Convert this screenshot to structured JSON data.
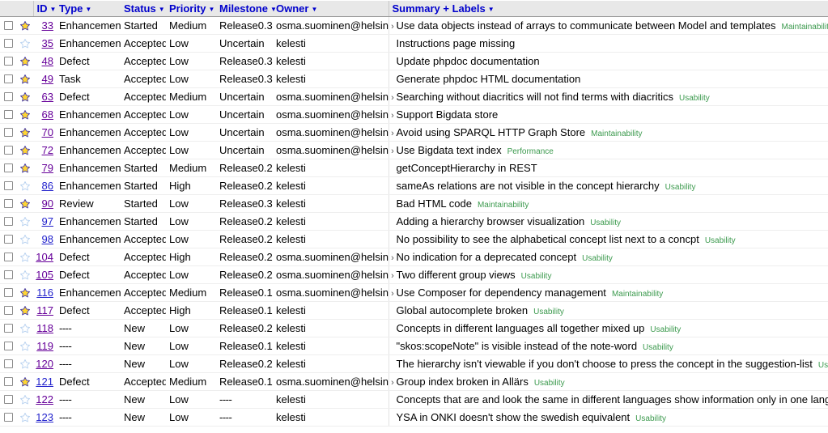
{
  "table": {
    "columns": [
      {
        "key": "check",
        "label": "",
        "sortable": false
      },
      {
        "key": "star",
        "label": "",
        "sortable": false
      },
      {
        "key": "id",
        "label": "ID",
        "sortable": true
      },
      {
        "key": "type",
        "label": "Type",
        "sortable": true
      },
      {
        "key": "status",
        "label": "Status",
        "sortable": true
      },
      {
        "key": "priority",
        "label": "Priority",
        "sortable": true
      },
      {
        "key": "milestone",
        "label": "Milestone",
        "sortable": true
      },
      {
        "key": "owner",
        "label": "Owner",
        "sortable": true
      },
      {
        "key": "summary",
        "label": "Summary + Labels",
        "sortable": true
      }
    ],
    "sort_caret": "▼",
    "expand_arrow": "›",
    "colors": {
      "header_text": "#0000cc",
      "header_bg": "#e8e8e8",
      "link_visited": "#660099",
      "link_unvisited": "#2222cc",
      "label_green": "#3c9a4e",
      "star_filled": "#ffd633",
      "star_empty": "#b9d2f0"
    },
    "rows": [
      {
        "checked": false,
        "starred": true,
        "id": "33",
        "id_visited": true,
        "type": "Enhancement",
        "status": "Started",
        "priority": "Medium",
        "milestone": "Release0.3",
        "owner": "osma.suominen@helsinki.fi",
        "expandable": true,
        "summary": "Use data objects instead of arrays to communicate between Model and templates",
        "labels": [
          "Maintainability"
        ]
      },
      {
        "checked": false,
        "starred": false,
        "id": "35",
        "id_visited": true,
        "type": "Enhancement",
        "status": "Accepted",
        "priority": "Low",
        "milestone": "Uncertain",
        "owner": "kelesti",
        "expandable": false,
        "summary": "Instructions page missing",
        "labels": []
      },
      {
        "checked": false,
        "starred": true,
        "id": "48",
        "id_visited": true,
        "type": "Defect",
        "status": "Accepted",
        "priority": "Low",
        "milestone": "Release0.3",
        "owner": "kelesti",
        "expandable": false,
        "summary": "Update phpdoc documentation",
        "labels": []
      },
      {
        "checked": false,
        "starred": true,
        "id": "49",
        "id_visited": true,
        "type": "Task",
        "status": "Accepted",
        "priority": "Low",
        "milestone": "Release0.3",
        "owner": "kelesti",
        "expandable": false,
        "summary": "Generate phpdoc HTML documentation",
        "labels": []
      },
      {
        "checked": false,
        "starred": true,
        "id": "63",
        "id_visited": true,
        "type": "Defect",
        "status": "Accepted",
        "priority": "Medium",
        "milestone": "Uncertain",
        "owner": "osma.suominen@helsinki.fi",
        "expandable": true,
        "summary": "Searching without diacritics will not find terms with diacritics",
        "labels": [
          "Usability"
        ]
      },
      {
        "checked": false,
        "starred": true,
        "id": "68",
        "id_visited": true,
        "type": "Enhancement",
        "status": "Accepted",
        "priority": "Low",
        "milestone": "Uncertain",
        "owner": "osma.suominen@helsinki.fi",
        "expandable": true,
        "summary": "Support Bigdata store",
        "labels": []
      },
      {
        "checked": false,
        "starred": true,
        "id": "70",
        "id_visited": true,
        "type": "Enhancement",
        "status": "Accepted",
        "priority": "Low",
        "milestone": "Uncertain",
        "owner": "osma.suominen@helsinki.fi",
        "expandable": true,
        "summary": "Avoid using SPARQL HTTP Graph Store",
        "labels": [
          "Maintainability"
        ]
      },
      {
        "checked": false,
        "starred": true,
        "id": "72",
        "id_visited": true,
        "type": "Enhancement",
        "status": "Accepted",
        "priority": "Low",
        "milestone": "Uncertain",
        "owner": "osma.suominen@helsinki.fi",
        "expandable": true,
        "summary": "Use Bigdata text index",
        "labels": [
          "Performance"
        ]
      },
      {
        "checked": false,
        "starred": true,
        "id": "79",
        "id_visited": true,
        "type": "Enhancement",
        "status": "Started",
        "priority": "Medium",
        "milestone": "Release0.2",
        "owner": "kelesti",
        "expandable": false,
        "summary": "getConceptHierarchy in REST",
        "labels": []
      },
      {
        "checked": false,
        "starred": false,
        "id": "86",
        "id_visited": false,
        "type": "Enhancement",
        "status": "Started",
        "priority": "High",
        "milestone": "Release0.2",
        "owner": "kelesti",
        "expandable": false,
        "summary": "sameAs relations are not visible in the concept hierarchy",
        "labels": [
          "Usability"
        ]
      },
      {
        "checked": false,
        "starred": true,
        "id": "90",
        "id_visited": true,
        "type": "Review",
        "status": "Started",
        "priority": "Low",
        "milestone": "Release0.3",
        "owner": "kelesti",
        "expandable": false,
        "summary": "Bad HTML code",
        "labels": [
          "Maintainability"
        ]
      },
      {
        "checked": false,
        "starred": false,
        "id": "97",
        "id_visited": false,
        "type": "Enhancement",
        "status": "Started",
        "priority": "Low",
        "milestone": "Release0.2",
        "owner": "kelesti",
        "expandable": false,
        "summary": "Adding a hierarchy browser visualization",
        "labels": [
          "Usability"
        ]
      },
      {
        "checked": false,
        "starred": false,
        "id": "98",
        "id_visited": false,
        "type": "Enhancement",
        "status": "Accepted",
        "priority": "Low",
        "milestone": "Release0.2",
        "owner": "kelesti",
        "expandable": false,
        "summary": "No possibility to see the alphabetical concept list next to a concpt",
        "labels": [
          "Usability"
        ]
      },
      {
        "checked": false,
        "starred": false,
        "id": "104",
        "id_visited": true,
        "type": "Defect",
        "status": "Accepted",
        "priority": "High",
        "milestone": "Release0.2",
        "owner": "osma.suominen@helsinki.fi",
        "expandable": true,
        "summary": "No indication for a deprecated concept",
        "labels": [
          "Usability"
        ]
      },
      {
        "checked": false,
        "starred": false,
        "id": "105",
        "id_visited": true,
        "type": "Defect",
        "status": "Accepted",
        "priority": "Low",
        "milestone": "Release0.2",
        "owner": "osma.suominen@helsinki.fi",
        "expandable": true,
        "summary": "Two different group views",
        "labels": [
          "Usability"
        ]
      },
      {
        "checked": false,
        "starred": true,
        "id": "116",
        "id_visited": false,
        "type": "Enhancement",
        "status": "Accepted",
        "priority": "Medium",
        "milestone": "Release0.1",
        "owner": "osma.suominen@helsinki.fi",
        "expandable": true,
        "summary": "Use Composer for dependency management",
        "labels": [
          "Maintainability"
        ]
      },
      {
        "checked": false,
        "starred": true,
        "id": "117",
        "id_visited": true,
        "type": "Defect",
        "status": "Accepted",
        "priority": "High",
        "milestone": "Release0.1",
        "owner": "kelesti",
        "expandable": false,
        "summary": "Global autocomplete broken",
        "labels": [
          "Usability"
        ]
      },
      {
        "checked": false,
        "starred": false,
        "id": "118",
        "id_visited": true,
        "type": "----",
        "status": "New",
        "priority": "Low",
        "milestone": "Release0.2",
        "owner": "kelesti",
        "expandable": false,
        "summary": "Concepts in different languages all together mixed up",
        "labels": [
          "Usability"
        ]
      },
      {
        "checked": false,
        "starred": false,
        "id": "119",
        "id_visited": true,
        "type": "----",
        "status": "New",
        "priority": "Low",
        "milestone": "Release0.1",
        "owner": "kelesti",
        "expandable": false,
        "summary": "\"skos:scopeNote\" is visible instead of the note-word",
        "labels": [
          "Usability"
        ]
      },
      {
        "checked": false,
        "starred": false,
        "id": "120",
        "id_visited": true,
        "type": "----",
        "status": "New",
        "priority": "Low",
        "milestone": "Release0.2",
        "owner": "kelesti",
        "expandable": false,
        "summary": "The hierarchy isn't viewable if you don't choose to press the concept in the suggestion-list",
        "labels": [
          "Usability"
        ]
      },
      {
        "checked": false,
        "starred": true,
        "id": "121",
        "id_visited": false,
        "type": "Defect",
        "status": "Accepted",
        "priority": "Medium",
        "milestone": "Release0.1",
        "owner": "osma.suominen@helsinki.fi",
        "expandable": true,
        "summary": "Group index broken in Allärs",
        "labels": [
          "Usability"
        ]
      },
      {
        "checked": false,
        "starred": false,
        "id": "122",
        "id_visited": true,
        "type": "----",
        "status": "New",
        "priority": "Low",
        "milestone": "----",
        "owner": "kelesti",
        "expandable": false,
        "summary": "Concepts that are and look the same in different languages show information only in one language",
        "labels": [
          "Usability"
        ]
      },
      {
        "checked": false,
        "starred": false,
        "id": "123",
        "id_visited": false,
        "type": "----",
        "status": "New",
        "priority": "Low",
        "milestone": "----",
        "owner": "kelesti",
        "expandable": false,
        "summary": "YSA in ONKI doesn't show the swedish equivalent",
        "labels": [
          "Usability"
        ]
      }
    ]
  }
}
